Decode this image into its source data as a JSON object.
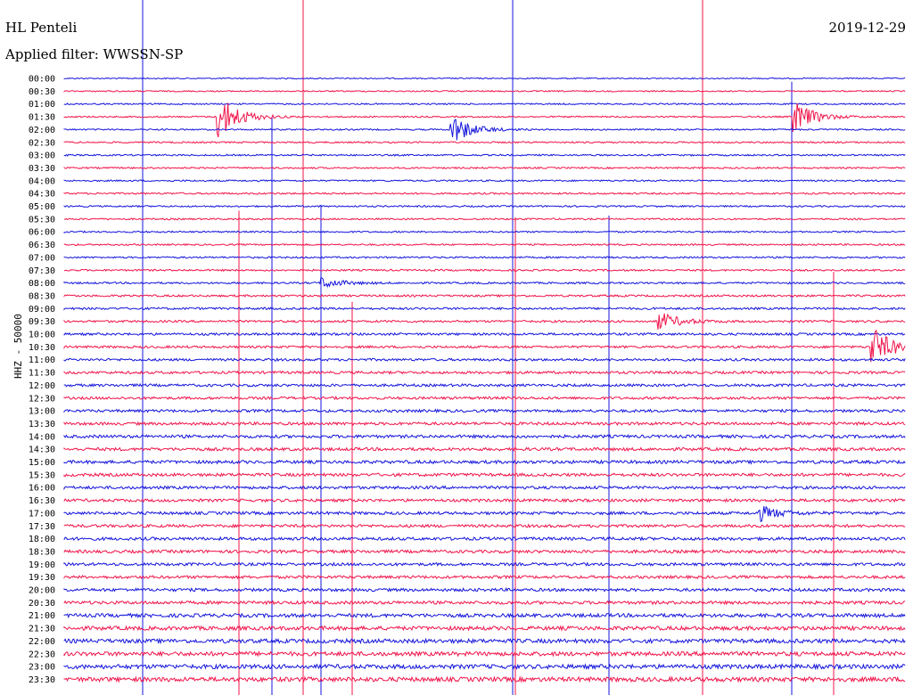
{
  "header": {
    "station": "HL Penteli",
    "filter": "Applied filter: WWSSN-SP",
    "date": "2019-12-29"
  },
  "channel_label": "HHZ - 50000",
  "colors": {
    "blue": "#1414dc",
    "red": "#f0144a"
  },
  "chart_data": {
    "type": "helicorder",
    "title": "HL Penteli",
    "subtitle": "Applied filter: WWSSN-SP",
    "date": "2019-12-29",
    "ylabel": "HHZ - 50000",
    "row_minutes": 30,
    "color_cycle": [
      "blue",
      "red"
    ],
    "rows": [
      "00:00",
      "00:30",
      "01:00",
      "01:30",
      "02:00",
      "02:30",
      "03:00",
      "03:30",
      "04:00",
      "04:30",
      "05:00",
      "05:30",
      "06:00",
      "06:30",
      "07:00",
      "07:30",
      "08:00",
      "08:30",
      "09:00",
      "09:30",
      "10:00",
      "10:30",
      "11:00",
      "11:30",
      "12:00",
      "12:30",
      "13:00",
      "13:30",
      "14:00",
      "14:30",
      "15:00",
      "15:30",
      "16:00",
      "16:30",
      "17:00",
      "17:30",
      "18:00",
      "18:30",
      "19:00",
      "19:30",
      "20:00",
      "20:30",
      "21:00",
      "21:30",
      "22:00",
      "22:30",
      "23:00",
      "23:30"
    ],
    "noise_level": [
      0.4,
      0.45,
      0.5,
      0.5,
      0.5,
      0.55,
      0.55,
      0.55,
      0.55,
      0.6,
      0.55,
      0.55,
      0.55,
      0.55,
      0.6,
      0.6,
      0.65,
      0.7,
      0.75,
      0.75,
      0.8,
      0.8,
      0.85,
      0.9,
      0.9,
      0.9,
      0.95,
      1.0,
      1.05,
      1.05,
      1.1,
      1.05,
      1.0,
      1.0,
      1.0,
      1.0,
      1.05,
      1.05,
      1.0,
      1.0,
      1.05,
      1.1,
      1.25,
      1.35,
      1.4,
      1.45,
      1.5,
      1.55
    ],
    "events": [
      {
        "row": "01:30",
        "minute": 5.5,
        "amplitude": 4.5
      },
      {
        "row": "02:00",
        "minute": 13.8,
        "amplitude": 3.0
      },
      {
        "row": "01:30",
        "minute": 26.0,
        "amplitude": 3.2
      },
      {
        "row": "09:30",
        "minute": 21.2,
        "amplitude": 1.8
      },
      {
        "row": "10:30",
        "minute": 28.8,
        "amplitude": 3.8
      },
      {
        "row": "17:00",
        "minute": 24.8,
        "amplitude": 1.4
      },
      {
        "row": "08:00",
        "minute": 9.2,
        "amplitude": 1.0
      }
    ]
  }
}
